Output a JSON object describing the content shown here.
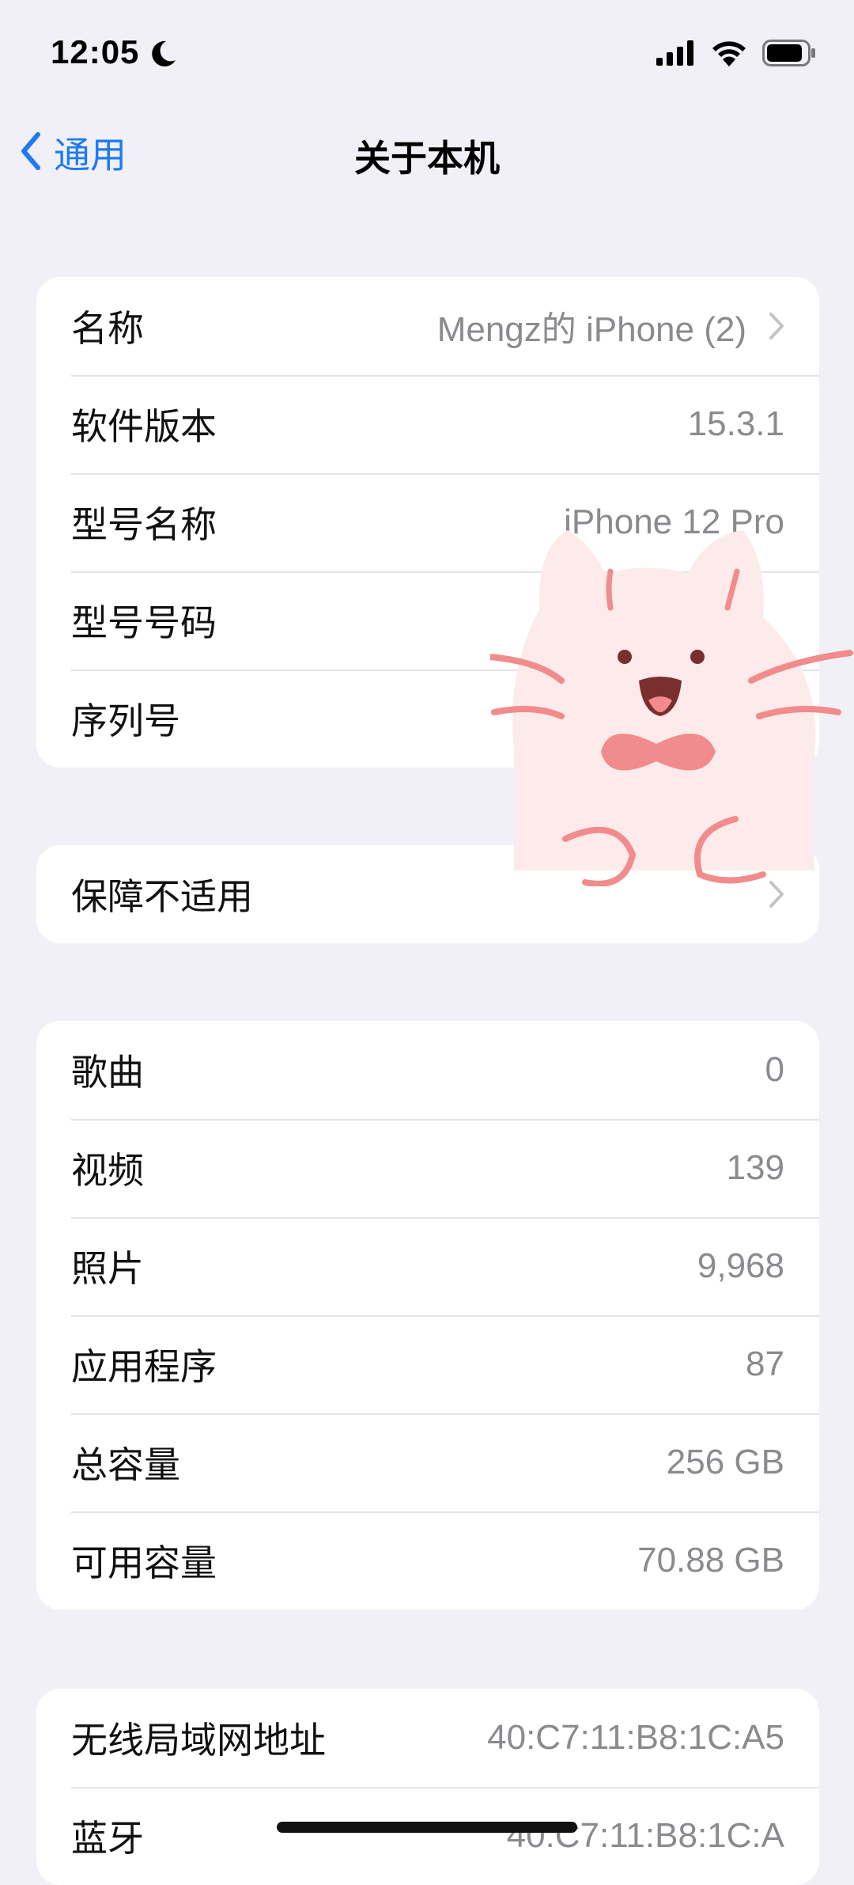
{
  "status": {
    "time": "12:05"
  },
  "nav": {
    "back_label": "通用",
    "title": "关于本机"
  },
  "group1": [
    {
      "label": "名称",
      "value": "Mengz的 iPhone (2)",
      "chevron": true
    },
    {
      "label": "软件版本",
      "value": "15.3.1"
    },
    {
      "label": "型号名称",
      "value": "iPhone 12 Pro"
    },
    {
      "label": "型号号码",
      "value": ""
    },
    {
      "label": "序列号",
      "value": ""
    }
  ],
  "group2": [
    {
      "label": "保障不适用",
      "chevron": true
    }
  ],
  "group3": [
    {
      "label": "歌曲",
      "value": "0"
    },
    {
      "label": "视频",
      "value": "139"
    },
    {
      "label": "照片",
      "value": "9,968"
    },
    {
      "label": "应用程序",
      "value": "87"
    },
    {
      "label": "总容量",
      "value": "256 GB"
    },
    {
      "label": "可用容量",
      "value": "70.88 GB"
    }
  ],
  "group4": [
    {
      "label": "无线局域网地址",
      "value": "40:C7:11:B8:1C:A5"
    },
    {
      "label": "蓝牙",
      "value": "40:C7:11:B8:1C:A"
    }
  ],
  "colors": {
    "accent": "#1d7bf3",
    "background": "#f1f0f6",
    "value_text": "#8a8a8f"
  }
}
